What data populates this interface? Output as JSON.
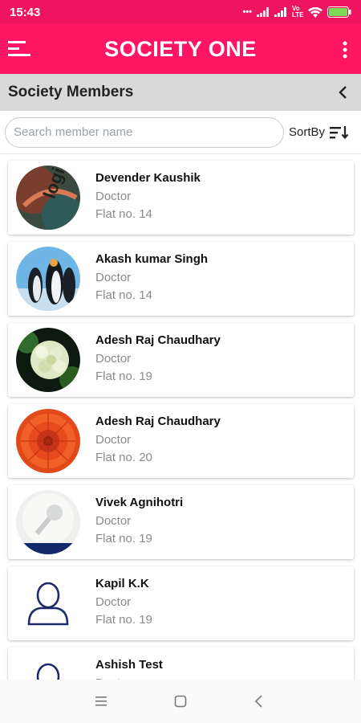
{
  "status_bar": {
    "time": "15:43",
    "network": "Vo LTE"
  },
  "app_bar": {
    "title": "SOCIETY ONE",
    "menu_icon": "hamburger-menu-icon",
    "more_icon": "more-vertical-icon"
  },
  "section": {
    "title": "Society Members",
    "back_icon": "chevron-left-icon"
  },
  "search": {
    "placeholder": "Search member name",
    "value": ""
  },
  "sort": {
    "label": "SortBy",
    "icon": "sort-icon"
  },
  "members": [
    {
      "name": "Devender Kaushik",
      "role": "Doctor",
      "flat": "Flat no. 14",
      "avatar": "photo-logo"
    },
    {
      "name": "Akash kumar Singh",
      "role": "Doctor",
      "flat": "Flat no. 14",
      "avatar": "photo-penguins"
    },
    {
      "name": "Adesh Raj Chaudhary",
      "role": "Doctor",
      "flat": "Flat no. 19",
      "avatar": "photo-hydrangea"
    },
    {
      "name": "Adesh Raj Chaudhary",
      "role": "Doctor",
      "flat": "Flat no. 20",
      "avatar": "photo-red-flower"
    },
    {
      "name": "Vivek Agnihotri",
      "role": "Doctor",
      "flat": "Flat no. 19",
      "avatar": "photo-lamp"
    },
    {
      "name": "Kapil K.K",
      "role": "Doctor",
      "flat": "Flat no. 19",
      "avatar": "person-placeholder-icon"
    },
    {
      "name": "Ashish Test",
      "role": "Doctor",
      "flat": "",
      "avatar": "person-placeholder-icon"
    }
  ],
  "colors": {
    "brand": "#ff1663",
    "status_bar": "#ee1460",
    "header_bg": "#d9d9d9",
    "placeholder_icon": "#1d2a6b"
  },
  "nav": {
    "recents_icon": "recents-icon",
    "home_icon": "home-icon",
    "back_icon": "nav-back-icon"
  }
}
